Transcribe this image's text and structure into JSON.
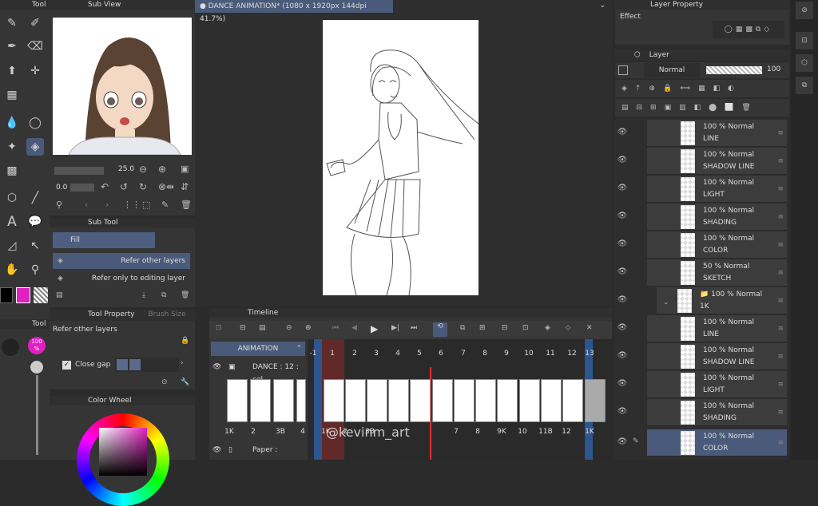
{
  "tool_panel": {
    "title": "Tool"
  },
  "sub_view": {
    "title": "Sub View"
  },
  "canvas": {
    "tab_title": "DANCE ANIMATION* (1080 x 1920px 144dpi 41.7%)"
  },
  "layer_property": {
    "title": "Layer Property",
    "effect_label": "Effect"
  },
  "layer_panel": {
    "title": "Layer",
    "blend_mode": "Normal",
    "opacity": "100",
    "layers": [
      {
        "opacity": "100 %",
        "mode": "Normal",
        "name": "LINE"
      },
      {
        "opacity": "100 %",
        "mode": "Normal",
        "name": "SHADOW LINE"
      },
      {
        "opacity": "100 %",
        "mode": "Normal",
        "name": "LIGHT"
      },
      {
        "opacity": "100 %",
        "mode": "Normal",
        "name": "SHADING"
      },
      {
        "opacity": "100 %",
        "mode": "Normal",
        "name": "COLOR"
      },
      {
        "opacity": "50 %",
        "mode": "Normal",
        "name": "SKETCH"
      },
      {
        "opacity": "100 %",
        "mode": "Normal",
        "name": "1K"
      },
      {
        "opacity": "100 %",
        "mode": "Normal",
        "name": "LINE"
      },
      {
        "opacity": "100 %",
        "mode": "Normal",
        "name": "SHADOW LINE"
      },
      {
        "opacity": "100 %",
        "mode": "Normal",
        "name": "LIGHT"
      },
      {
        "opacity": "100 %",
        "mode": "Normal",
        "name": "SHADING"
      },
      {
        "opacity": "100 %",
        "mode": "Normal",
        "name": "COLOR"
      }
    ]
  },
  "brush": {
    "size": "25.0",
    "value2": "0.0"
  },
  "sub_tool": {
    "title": "Sub Tool",
    "group": "Fill",
    "items": [
      "Refer other layers",
      "Refer only to editing layer"
    ]
  },
  "tool_property": {
    "title": "Tool Property",
    "tab2": "Brush Size",
    "subtool_name": "Refer other layers",
    "close_gap_label": "Close gap"
  },
  "color_wheel": {
    "title": "Color Wheel",
    "opacity_label": "100\n%"
  },
  "timeline": {
    "title": "Timeline",
    "animation_label": "ANIMATION",
    "cel_track": "DANCE : 12 : cel",
    "paper_track": "Paper :",
    "frame_numbers": [
      "-1",
      "1",
      "2",
      "3",
      "4",
      "5",
      "6",
      "7",
      "8",
      "9",
      "10",
      "11",
      "12",
      "13"
    ],
    "left_thumb_labels": [
      "1K",
      "2",
      "3B",
      "4"
    ],
    "cel_labels": [
      "1K",
      "2",
      "3B",
      "",
      "",
      "",
      "7",
      "8",
      "9K",
      "10",
      "11B",
      "12",
      "1K"
    ],
    "watermark": "@kevinm_art"
  },
  "colors": {
    "accent": "#e020c0",
    "selection": "#4a5a7a",
    "playhead": "#e03030"
  }
}
